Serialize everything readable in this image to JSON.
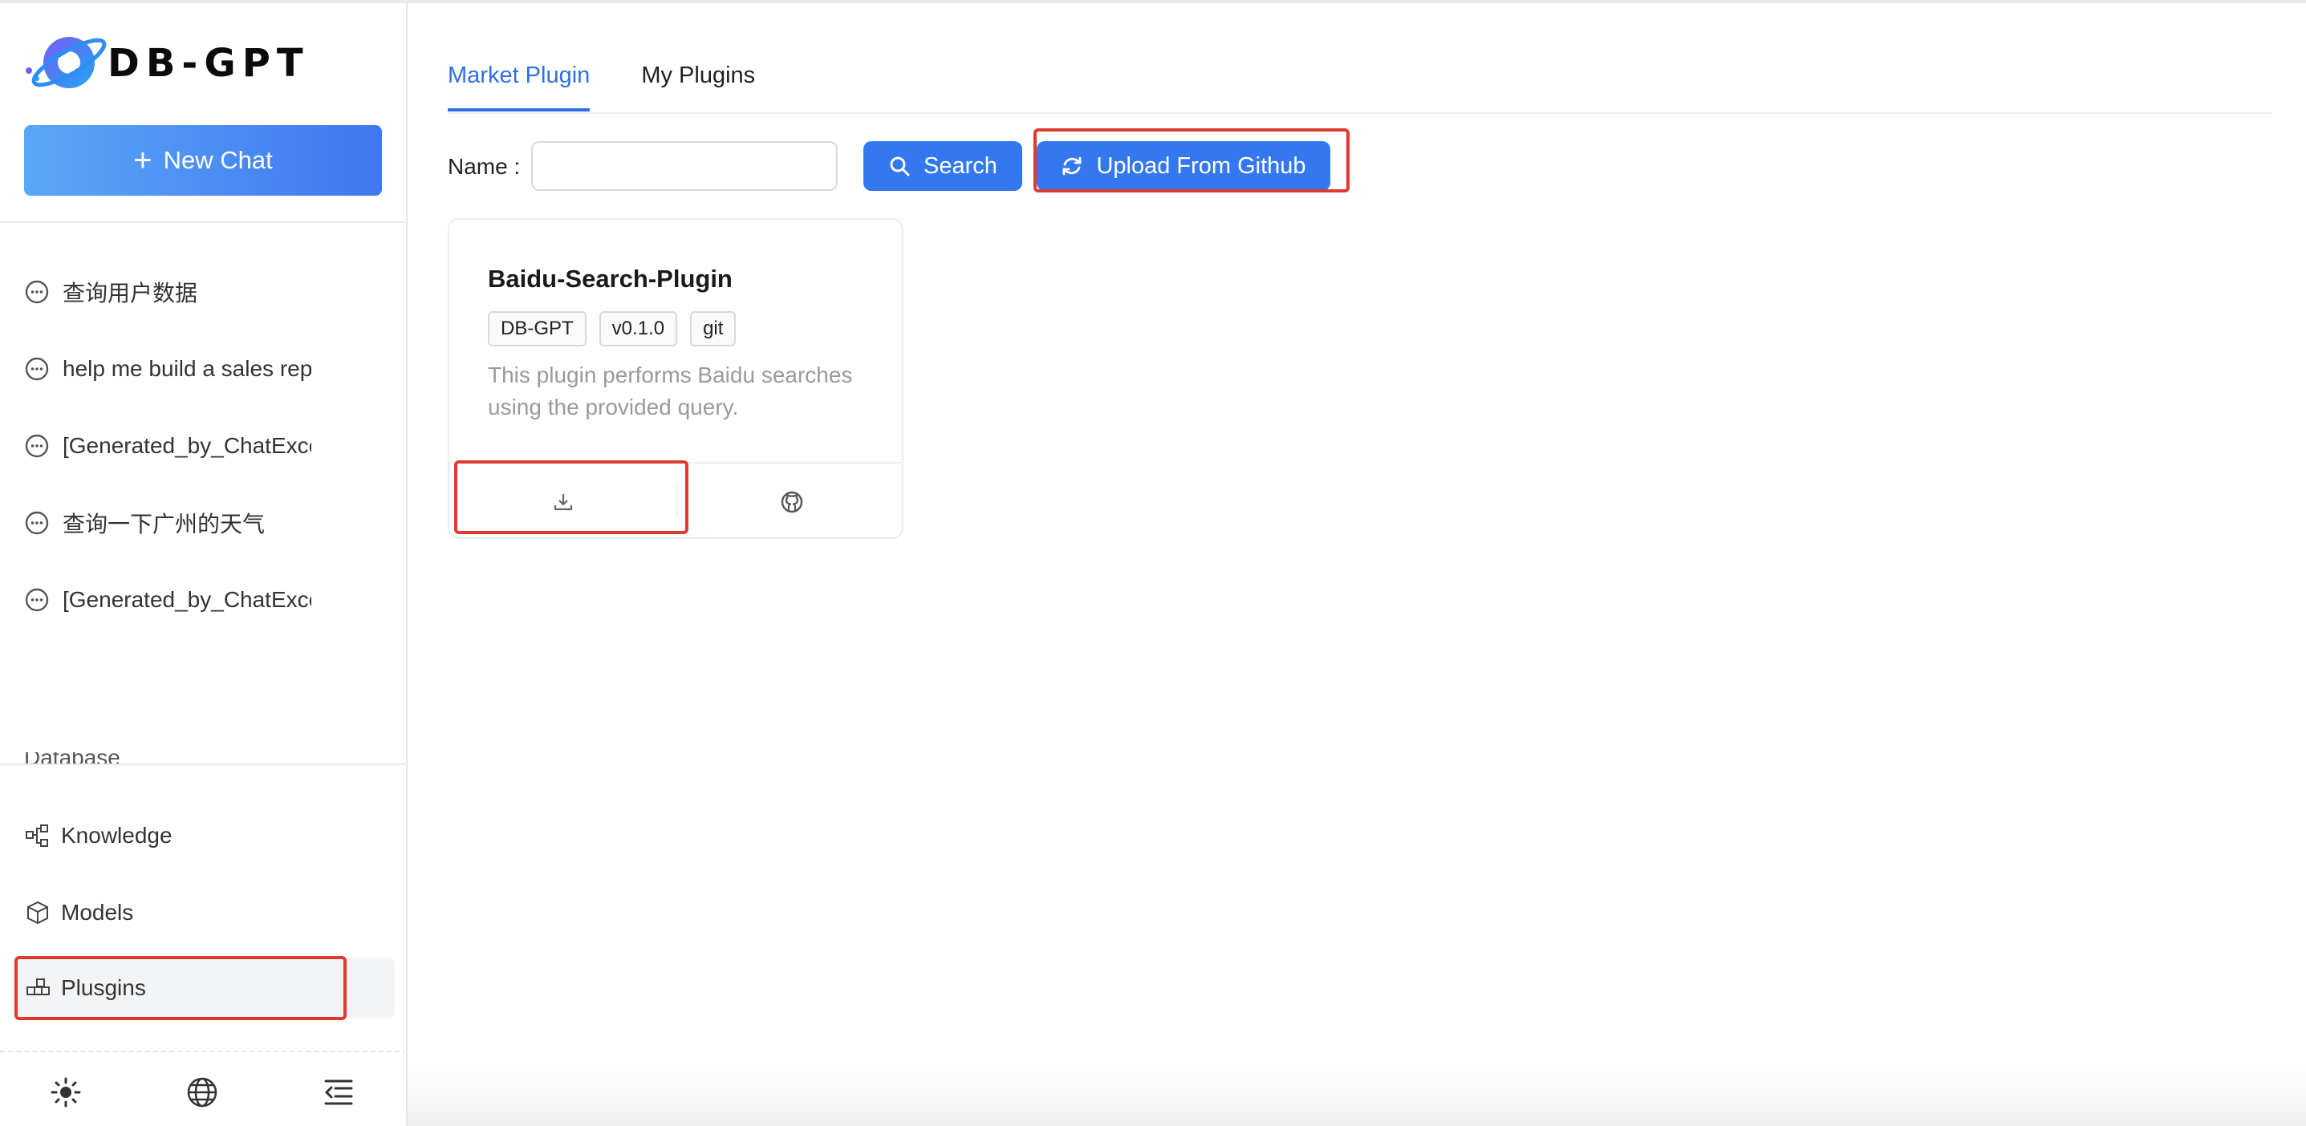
{
  "app": {
    "logo_text": "DB-GPT"
  },
  "sidebar": {
    "new_chat_label": "New Chat",
    "chats": [
      {
        "label": "查询用户数据"
      },
      {
        "label": "help me build a sales rep"
      },
      {
        "label": "[Generated_by_ChatExcel"
      },
      {
        "label": "查询一下广州的天气"
      },
      {
        "label": "[Generated_by_ChatExcel"
      }
    ],
    "cut_off_item": "Database",
    "menu": [
      {
        "label": "Knowledge",
        "icon": "knowledge-icon"
      },
      {
        "label": "Models",
        "icon": "models-icon"
      },
      {
        "label": "Plusgins",
        "icon": "plugins-icon",
        "active": true
      }
    ],
    "bottom_icons": [
      "theme-sun-icon",
      "language-globe-icon",
      "collapse-menu-icon"
    ]
  },
  "main": {
    "tabs": [
      {
        "label": "Market Plugin",
        "active": true
      },
      {
        "label": "My Plugins"
      }
    ],
    "search": {
      "name_label": "Name",
      "input_value": "",
      "search_label": "Search",
      "upload_label": "Upload From Github"
    },
    "plugins": [
      {
        "title": "Baidu-Search-Plugin",
        "tags": [
          "DB-GPT",
          "v0.1.0",
          "git"
        ],
        "description": "This plugin performs Baidu searches using the provided query.",
        "actions": [
          "download-icon",
          "github-icon"
        ]
      }
    ]
  },
  "colors": {
    "accent": "#3478f0",
    "highlight": "#e03a2f"
  }
}
